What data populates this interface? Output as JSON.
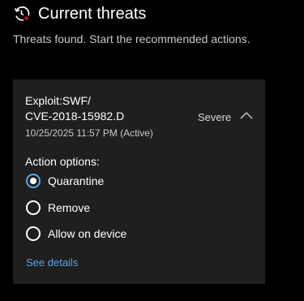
{
  "header": {
    "icon": "history-threat-icon",
    "title": "Current threats"
  },
  "subtitle": "Threats found. Start the recommended actions.",
  "threat": {
    "name_line1": "Exploit:SWF/",
    "name_line2": "CVE-2018-15982.D",
    "date": "10/25/2025 11:57 PM (Active)",
    "severity": "Severe",
    "expanded": true,
    "options_label": "Action options:",
    "options": [
      {
        "label": "Quarantine",
        "selected": true
      },
      {
        "label": "Remove",
        "selected": false
      },
      {
        "label": "Allow on device",
        "selected": false
      }
    ],
    "see_details": "See details"
  },
  "colors": {
    "background": "#000000",
    "card": "#1f1f1f",
    "accent": "#5aa3e6",
    "threat_red": "#e81123"
  }
}
